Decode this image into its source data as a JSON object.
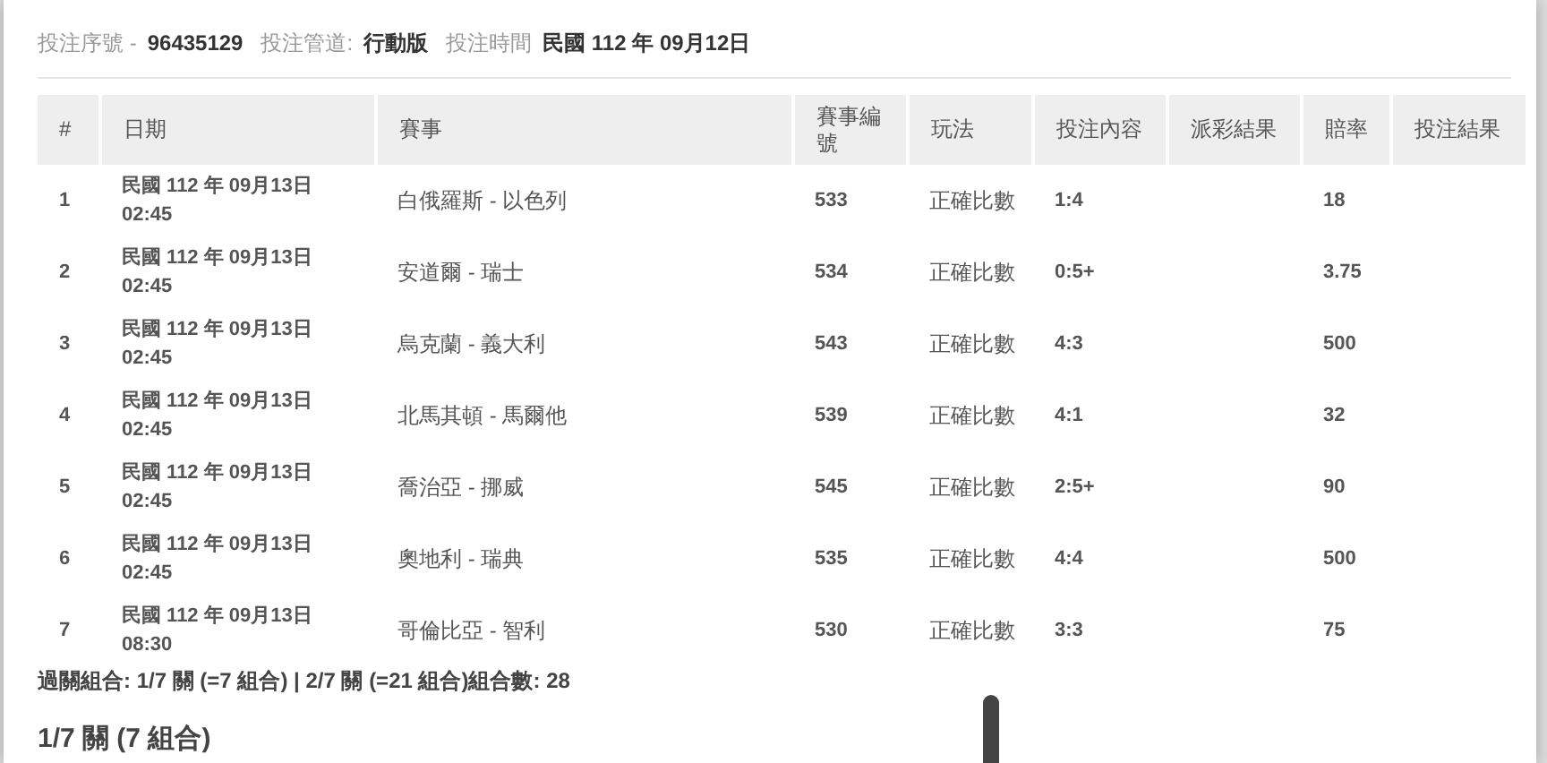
{
  "bet_info": [
    {
      "label": "投注序號 -",
      "value": "96435129"
    },
    {
      "label": "投注管道:",
      "value": "行動版"
    },
    {
      "label": "投注時間",
      "value": "民國 112 年 09月12日"
    }
  ],
  "table": {
    "columns": [
      "#",
      "日期",
      "賽事",
      "賽事編號",
      "玩法",
      "投注內容",
      "派彩結果",
      "賠率",
      "投注結果"
    ],
    "rows": [
      {
        "no": "1",
        "date": "民國 112 年 09月13日",
        "time": "02:45",
        "match": "白俄羅斯 - 以色列",
        "match_id": "533",
        "play": "正確比數",
        "pick": "1:4",
        "odds": "18"
      },
      {
        "no": "2",
        "date": "民國 112 年 09月13日",
        "time": "02:45",
        "match": "安道爾 - 瑞士",
        "match_id": "534",
        "play": "正確比數",
        "pick": "0:5+",
        "odds": "3.75"
      },
      {
        "no": "3",
        "date": "民國 112 年 09月13日",
        "time": "02:45",
        "match": "烏克蘭 - 義大利",
        "match_id": "543",
        "play": "正確比數",
        "pick": "4:3",
        "odds": "500"
      },
      {
        "no": "4",
        "date": "民國 112 年 09月13日",
        "time": "02:45",
        "match": "北馬其頓 - 馬爾他",
        "match_id": "539",
        "play": "正確比數",
        "pick": "4:1",
        "odds": "32"
      },
      {
        "no": "5",
        "date": "民國 112 年 09月13日",
        "time": "02:45",
        "match": "喬治亞 - 挪威",
        "match_id": "545",
        "play": "正確比數",
        "pick": "2:5+",
        "odds": "90"
      },
      {
        "no": "6",
        "date": "民國 112 年 09月13日",
        "time": "02:45",
        "match": "奧地利 - 瑞典",
        "match_id": "535",
        "play": "正確比數",
        "pick": "4:4",
        "odds": "500"
      },
      {
        "no": "7",
        "date": "民國 112 年 09月13日",
        "time": "08:30",
        "match": "哥倫比亞 - 智利",
        "match_id": "530",
        "play": "正確比數",
        "pick": "3:3",
        "odds": "75"
      }
    ]
  },
  "summary": "過關組合: 1/7 關 (=7 組合) | 2/7 關 (=21 組合)組合數: 28",
  "section_title": "1/7 關 (7 組合)"
}
